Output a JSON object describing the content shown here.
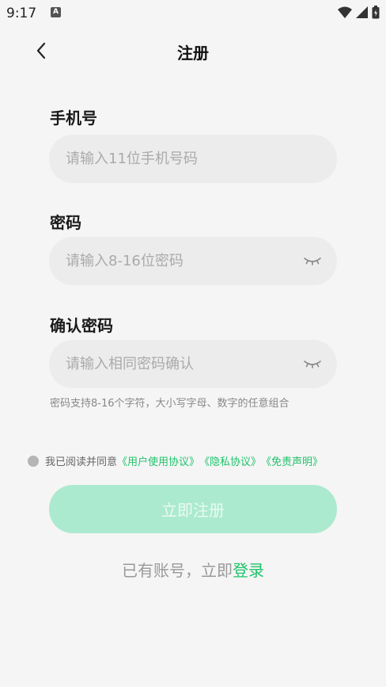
{
  "status_bar": {
    "time": "9:17",
    "notification_icon": "A"
  },
  "header": {
    "title": "注册"
  },
  "form": {
    "phone": {
      "label": "手机号",
      "placeholder": "请输入11位手机号码",
      "value": ""
    },
    "password": {
      "label": "密码",
      "placeholder": "请输入8-16位密码",
      "value": ""
    },
    "confirm_password": {
      "label": "确认密码",
      "placeholder": "请输入相同密码确认",
      "value": ""
    },
    "hint": "密码支持8-16个字符，大小写字母、数字的任意组合"
  },
  "agreement": {
    "text": "我已阅读并同意",
    "links": [
      "《用户使用协议》",
      "《隐私协议》",
      "《免责声明》"
    ]
  },
  "register_button": "立即注册",
  "login": {
    "prefix": "已有账号，立即",
    "link": "登录"
  },
  "colors": {
    "accent": "#1fc36b",
    "button_disabled": "#acead0",
    "field_background": "#ececec",
    "page_background": "#f5f5f5"
  }
}
